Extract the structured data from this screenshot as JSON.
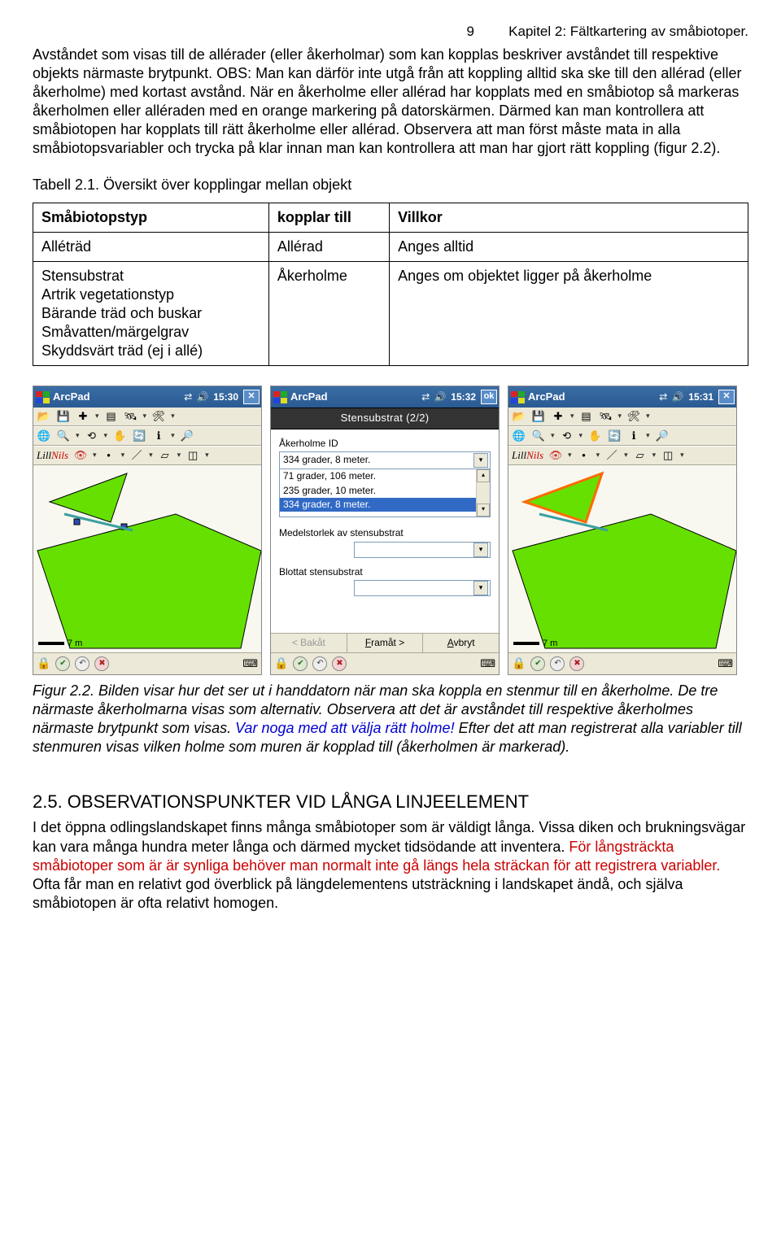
{
  "header": {
    "page_number": "9",
    "chapter": "Kapitel 2: Fältkartering av småbiotoper."
  },
  "intro_paragraph": "Avståndet som visas till de allérader (eller åkerholmar) som kan kopplas beskriver avståndet till respektive objekts närmaste brytpunkt. OBS: Man kan därför inte utgå från att koppling alltid ska ske till den allérad (eller åkerholme) med kortast avstånd. När en åkerholme eller allérad har kopplats med en småbiotop så markeras åkerholmen eller alléraden med en orange markering på datorskärmen. Därmed kan man kontrollera att småbiotopen har kopplats till rätt åkerholme eller allérad. Observera att man först måste mata in alla småbiotopsvariabler och trycka på klar innan man kan kontrollera att man har gjort rätt koppling (figur 2.2).",
  "table": {
    "caption": "Tabell 2.1. Översikt över kopplingar mellan objekt",
    "headers": {
      "c1": "Småbiotopstyp",
      "c2": "kopplar till",
      "c3": "Villkor"
    },
    "row1": {
      "c1": "Alléträd",
      "c2": "Allérad",
      "c3": "Anges alltid"
    },
    "row2": {
      "c1": "Stensubstrat\nArtrik vegetationstyp\nBärande träd och buskar\nSmåvatten/märgelgrav\nSkyddsvärt träd (ej i allé)",
      "c2": "Åkerholme",
      "c3": "Anges om objektet ligger på åkerholme"
    }
  },
  "device_left": {
    "app": "ArcPad",
    "time": "15:30",
    "close": "✕",
    "lill": {
      "black": "Lill",
      "red": "Nils"
    },
    "scale": "7 m"
  },
  "device_mid": {
    "app": "ArcPad",
    "time": "15:32",
    "ok": "ok",
    "form_title": "Stensubstrat (2/2)",
    "label_id": "Åkerholme ID",
    "combo_value": "334 grader, 8 meter.",
    "options": {
      "o1": "71 grader, 106 meter.",
      "o2": "235 grader, 10 meter.",
      "o3": "334 grader, 8 meter."
    },
    "label_medel": "Medelstorlek av stensubstrat",
    "label_blottat": "Blottat stensubstrat",
    "btn_back": "< Bakåt",
    "btn_fwd_pre": "F",
    "btn_fwd_rest": "ramåt >",
    "btn_cancel_pre": "A",
    "btn_cancel_rest": "vbryt"
  },
  "device_right": {
    "app": "ArcPad",
    "time": "15:31",
    "close": "✕",
    "lill": {
      "black": "Lill",
      "red": "Nils"
    },
    "scale": "7 m"
  },
  "figure_caption": {
    "lead": "Figur 2.2. Bilden visar hur det ser ut i handdatorn när man ska koppla en stenmur till en åkerholme. De tre närmaste åkerholmarna visas som alternativ. Observera att det är avståndet till respektive åkerholmes närmaste brytpunkt som visas. ",
    "blue": "Var noga med att välja rätt holme!",
    "tail": " Efter det att man registrerat alla variabler till stenmuren visas vilken holme som muren är kopplad till (åkerholmen är markerad)."
  },
  "section": {
    "heading": "2.5. OBSERVATIONSPUNKTER VID LÅNGA LINJEELEMENT",
    "para_a": "I det öppna odlingslandskapet finns många småbiotoper som är väldigt långa. Vissa diken och brukningsvägar kan vara många hundra meter långa och därmed mycket tidsödande att inventera. ",
    "para_red": "För långsträckta småbiotoper som är är synliga behöver man normalt inte gå längs hela sträckan för att registrera variabler.",
    "para_b": " Ofta får man en relativt god överblick på längdelementens utsträckning i landskapet ändå, och själva småbiotopen är ofta relativt homogen."
  }
}
